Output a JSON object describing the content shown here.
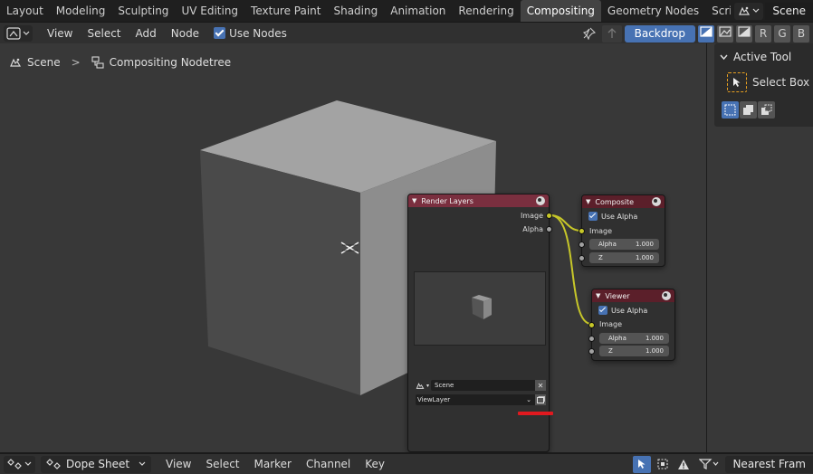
{
  "workspace_tabs": [
    "Layout",
    "Modeling",
    "Sculpting",
    "UV Editing",
    "Texture Paint",
    "Shading",
    "Animation",
    "Rendering",
    "Compositing",
    "Geometry Nodes",
    "Scripting"
  ],
  "active_tab": "Compositing",
  "add_tab_symbol": "+",
  "scene_name": "Scene",
  "header": {
    "menus": [
      "View",
      "Select",
      "Add",
      "Node"
    ],
    "use_nodes_label": "Use Nodes",
    "backdrop_label": "Backdrop",
    "channels": [
      "R",
      "G",
      "B"
    ]
  },
  "breadcrumb": {
    "scene": "Scene",
    "separator": ">",
    "nodetree": "Compositing Nodetree"
  },
  "nodes": {
    "render_layers": {
      "title": "Render Layers",
      "outputs": [
        "Image",
        "Alpha"
      ],
      "scene_field": "Scene",
      "view_layer": "ViewLayer"
    },
    "composite": {
      "title": "Composite",
      "use_alpha_label": "Use Alpha",
      "input_image": "Image",
      "alpha_label": "Alpha",
      "alpha_value": "1.000",
      "z_label": "Z",
      "z_value": "1.000"
    },
    "viewer": {
      "title": "Viewer",
      "use_alpha_label": "Use Alpha",
      "input_image": "Image",
      "alpha_label": "Alpha",
      "alpha_value": "1.000",
      "z_label": "Z",
      "z_value": "1.000"
    }
  },
  "sidebar": {
    "panel_title": "Active Tool",
    "tool_name": "Select Box"
  },
  "bottom": {
    "editor_name": "Dope Sheet",
    "menus": [
      "View",
      "Select",
      "Marker",
      "Channel",
      "Key"
    ],
    "snap_field": "Nearest Fram"
  },
  "colors": {
    "accent": "#4772b3",
    "render_layers_header": "#7a2f3f",
    "output_node_header": "#5b1f2a",
    "socket_image": "#c7c729",
    "socket_value": "#a1a1a1",
    "link": "#c7c729",
    "highlight_underline": "#e0191f"
  }
}
